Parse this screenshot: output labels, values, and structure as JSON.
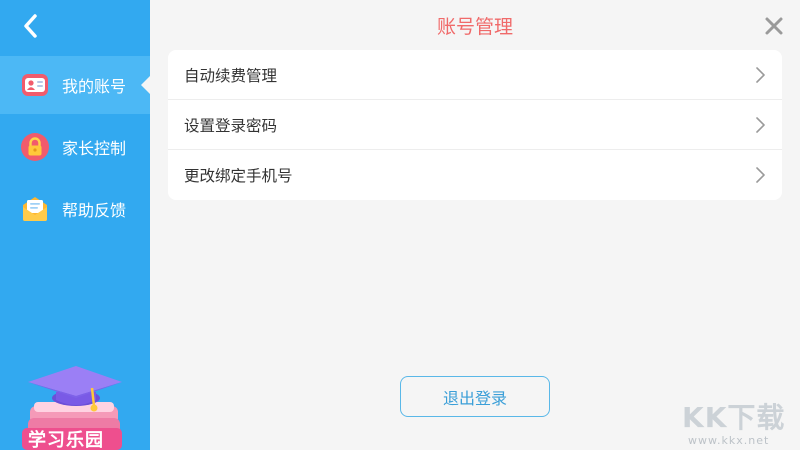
{
  "header": {
    "title": "账号管理"
  },
  "sidebar": {
    "items": [
      {
        "label": "我的账号",
        "icon": "id-card-icon",
        "active": true
      },
      {
        "label": "家长控制",
        "icon": "lock-icon",
        "active": false
      },
      {
        "label": "帮助反馈",
        "icon": "mail-icon",
        "active": false
      }
    ],
    "logo_text": "学习乐园"
  },
  "settings": {
    "rows": [
      {
        "label": "自动续费管理"
      },
      {
        "label": "设置登录密码"
      },
      {
        "label": "更改绑定手机号"
      }
    ]
  },
  "logout": {
    "label": "退出登录"
  },
  "watermark": {
    "brand": "KK下载",
    "url": "www.kkx.net"
  },
  "colors": {
    "sidebar": "#32a9f0",
    "sidebar_active": "#4cb8f5",
    "title": "#f06a6a",
    "button_border": "#5ab8e8"
  }
}
